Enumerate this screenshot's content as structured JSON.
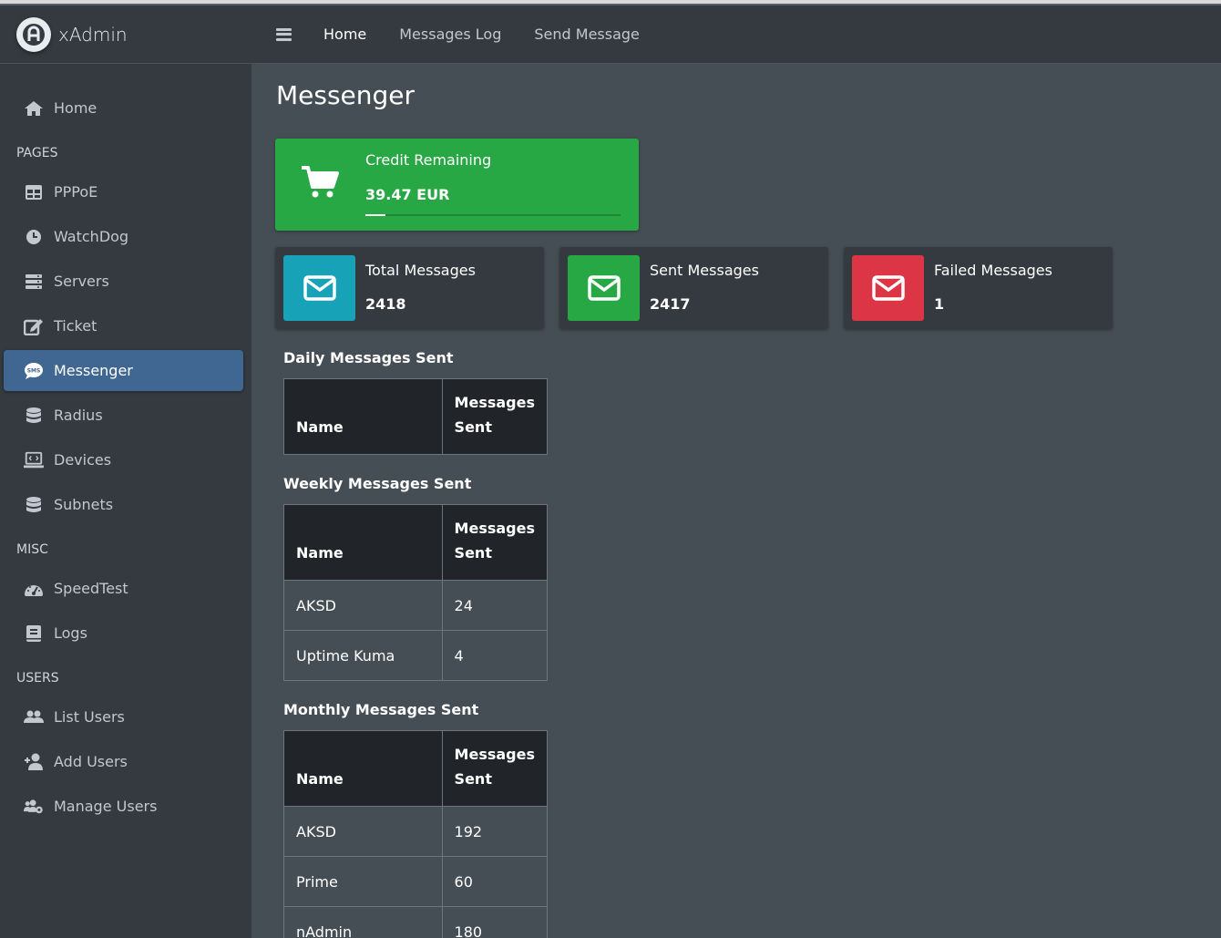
{
  "brand": {
    "name": "xAdmin"
  },
  "topnav": {
    "items": [
      "Home",
      "Messages Log",
      "Send Message"
    ]
  },
  "sidebar": {
    "home": "Home",
    "headers": {
      "pages": "PAGES",
      "misc": "MISC",
      "users": "USERS"
    },
    "pages": [
      "PPPoE",
      "WatchDog",
      "Servers",
      "Ticket",
      "Messenger",
      "Radius",
      "Devices",
      "Subnets"
    ],
    "misc": [
      "SpeedTest",
      "Logs"
    ],
    "users": [
      "List Users",
      "Add Users",
      "Manage Users"
    ],
    "active": "Messenger"
  },
  "page": {
    "title": "Messenger"
  },
  "credit": {
    "label": "Credit Remaining",
    "value": "39.47 EUR",
    "progress_fraction": 0.08
  },
  "stats": [
    {
      "label": "Total Messages",
      "value": "2418",
      "color": "#17a2b8"
    },
    {
      "label": "Sent Messages",
      "value": "2417",
      "color": "#28a745"
    },
    {
      "label": "Failed Messages",
      "value": "1",
      "color": "#dc3545"
    }
  ],
  "tables": {
    "col_name": "Name",
    "col_sent": "Messages Sent",
    "daily": {
      "title": "Daily Messages Sent",
      "rows": []
    },
    "weekly": {
      "title": "Weekly Messages Sent",
      "rows": [
        [
          "AKSD",
          "24"
        ],
        [
          "Uptime Kuma",
          "4"
        ]
      ]
    },
    "monthly": {
      "title": "Monthly Messages Sent",
      "rows": [
        [
          "AKSD",
          "192"
        ],
        [
          "Prime",
          "60"
        ],
        [
          "nAdmin",
          "180"
        ]
      ]
    }
  }
}
